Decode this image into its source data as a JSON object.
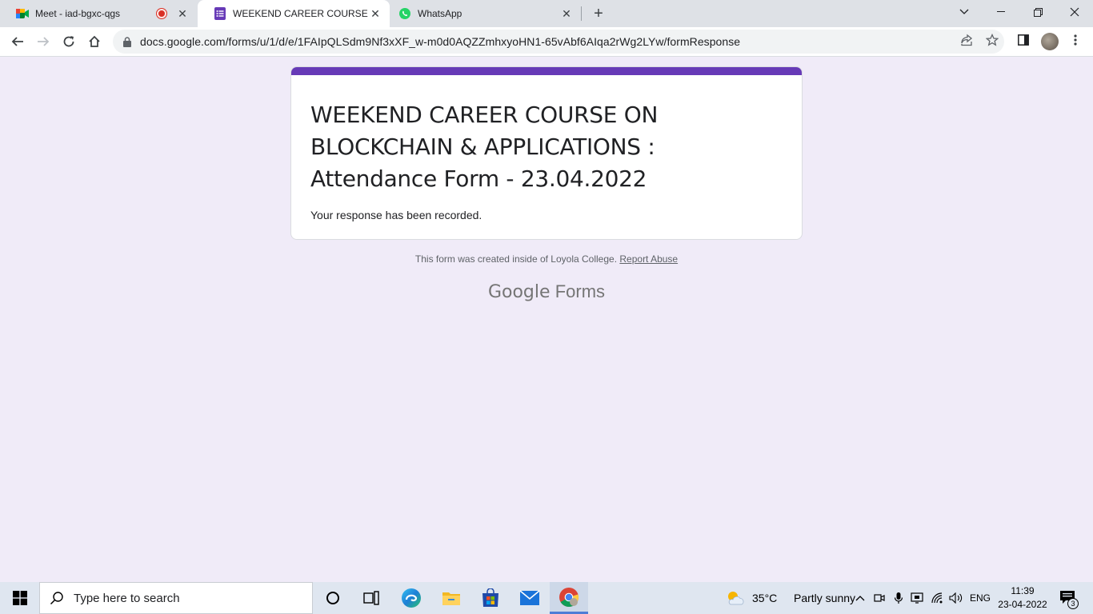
{
  "tabs": [
    {
      "title": "Meet - iad-bgxc-qgs",
      "icon": "google-meet-icon",
      "recording": true
    },
    {
      "title": "WEEKEND CAREER COURSE ON BLOCKCHAIN",
      "icon": "google-forms-icon",
      "active": true
    },
    {
      "title": "WhatsApp",
      "icon": "whatsapp-icon"
    }
  ],
  "address_bar": {
    "url": "docs.google.com/forms/u/1/d/e/1FAIpQLSdm9Nf3xXF_w-m0d0AQZZmhxyoHN1-65vAbf6AIqa2rWg2LYw/formResponse"
  },
  "form": {
    "title": "WEEKEND CAREER COURSE ON BLOCKCHAIN & APPLICATIONS : Attendance Form - 23.04.2022",
    "confirmation": "Your response has been recorded.",
    "accent_color": "#673ab7"
  },
  "footer": {
    "created_text": "This form was created inside of Loyola College.",
    "report_link": "Report Abuse",
    "brand_google": "Google",
    "brand_forms": "Forms"
  },
  "taskbar": {
    "search_placeholder": "Type here to search",
    "weather_temp": "35°C",
    "weather_desc": "Partly sunny",
    "language": "ENG",
    "time": "11:39",
    "date": "23-04-2022",
    "notification_count": "3"
  }
}
